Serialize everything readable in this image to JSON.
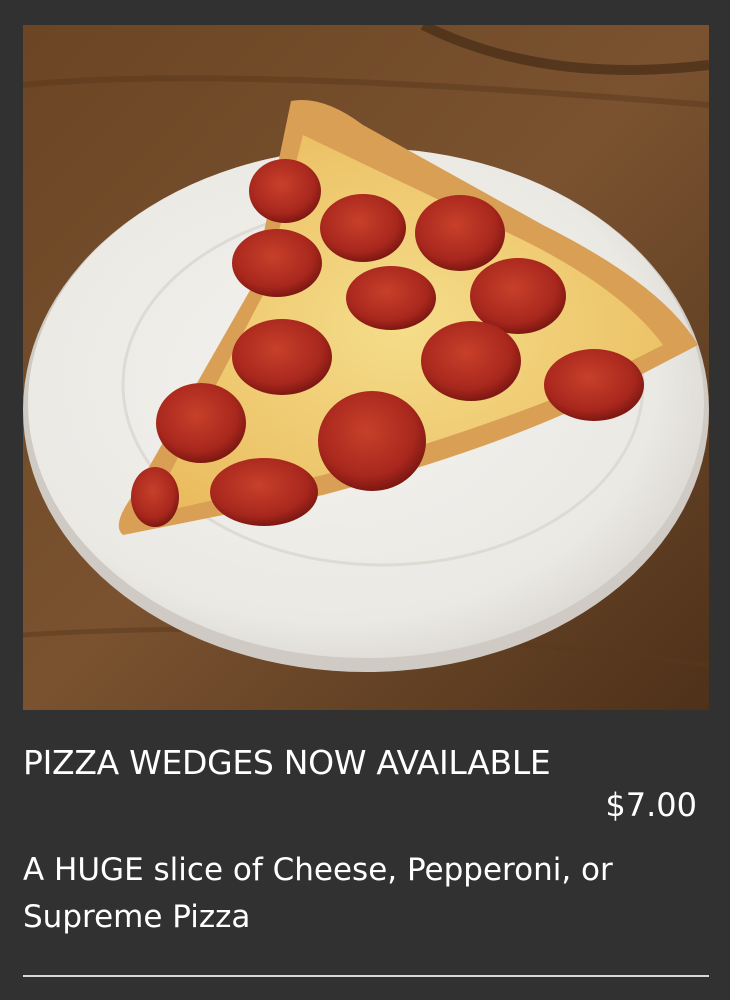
{
  "item": {
    "title": "PIZZA WEDGES NOW AVAILABLE",
    "price": "$7.00",
    "description": "A HUGE slice of Cheese, Pepperoni, or Supreme Pizza"
  },
  "colors": {
    "background": "#323132",
    "text": "#ffffff",
    "divider": "#d8d8d8"
  }
}
